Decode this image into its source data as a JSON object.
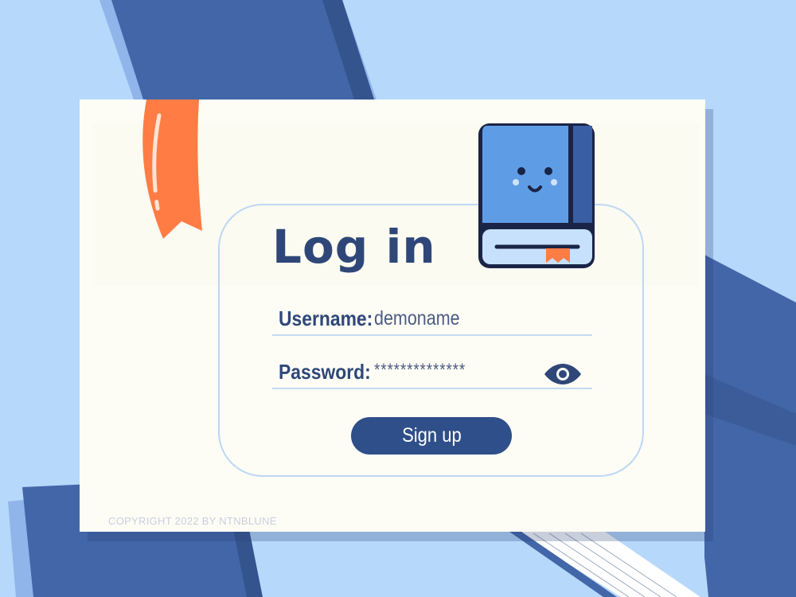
{
  "title": "Log in",
  "form": {
    "username_label": "Username:",
    "username_value": "demoname",
    "password_label": "Password:",
    "password_value": "**************",
    "signup_label": "Sign up"
  },
  "footer": {
    "copyright": "COPYRIGHT 2022 BY NTNBLUNE"
  },
  "icons": {
    "show_password": "eye-icon",
    "mascot": "book-mascot-icon",
    "bookmark": "bookmark-ribbon"
  },
  "colors": {
    "background": "#b6d8fb",
    "card": "#fdfdf6",
    "primary": "#2f4f8a",
    "heading": "#2f4778",
    "accent": "#ff7c45",
    "book_blue": "#5f9ce6"
  }
}
